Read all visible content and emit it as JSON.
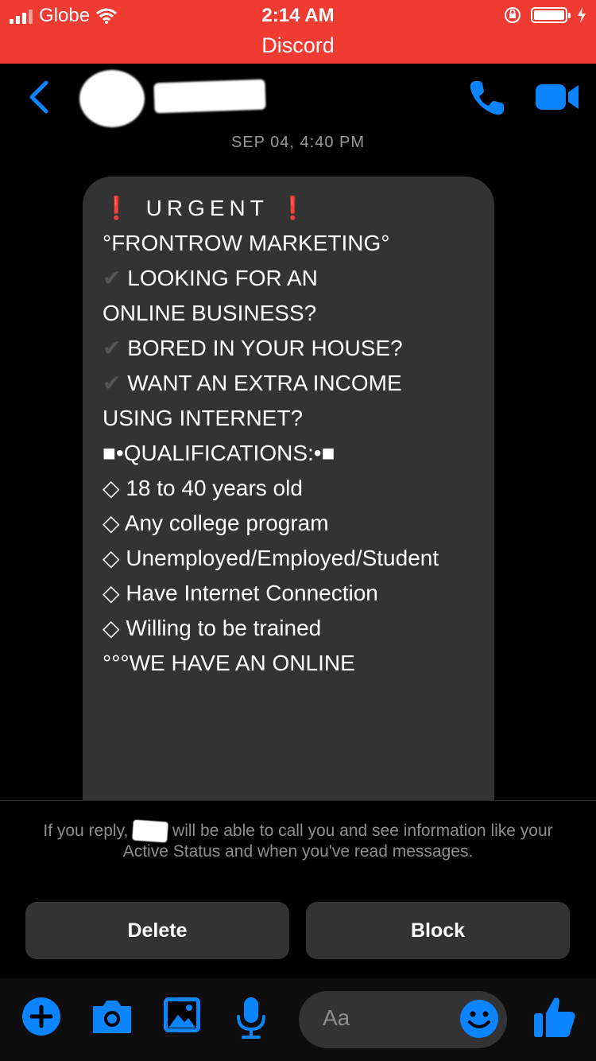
{
  "status_bar": {
    "carrier": "Globe",
    "time": "2:14 AM",
    "app_return": "Discord"
  },
  "header": {
    "contact_name": "",
    "icons": [
      "back-chevron-icon",
      "phone-icon",
      "video-camera-icon"
    ]
  },
  "timestamp": "SEP 04, 4:40 PM",
  "message": {
    "lines": [
      "URGENT",
      "°FRONTROW MARKETING°",
      "LOOKING FOR AN",
      "ONLINE BUSINESS?",
      "",
      "BORED IN YOUR HOUSE?",
      "",
      "WANT AN EXTRA INCOME",
      "USING INTERNET?",
      "",
      "•QUALIFICATIONS:•",
      "18 to 40 years old",
      "Any college program",
      "Unemployed/Employed/Student",
      "Have Internet Connection",
      "Willing to be trained",
      "",
      "°°°WE HAVE AN ONLINE"
    ]
  },
  "notice": {
    "part1": "If you reply,",
    "part2": "will be able to call you and see information like your Active Status and when you've read messages."
  },
  "actions": {
    "delete_label": "Delete",
    "block_label": "Block"
  },
  "composer": {
    "placeholder": "Aa"
  },
  "colors": {
    "status_bar_bg": "#ef3b32",
    "accent_blue": "#0a84ff",
    "bubble_bg": "#333333",
    "background": "#000000"
  }
}
